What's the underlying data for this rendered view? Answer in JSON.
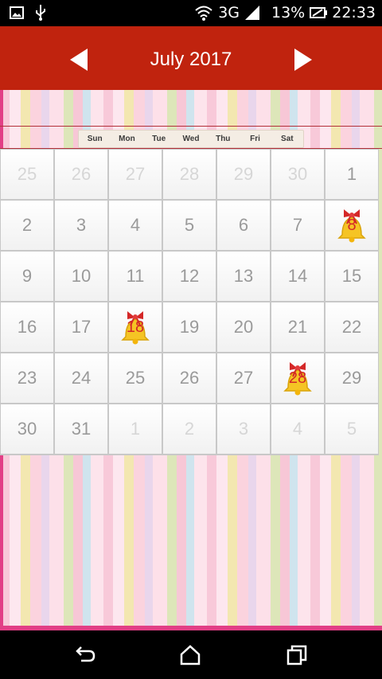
{
  "status_bar": {
    "network": "3G",
    "battery": "13%",
    "time": "22:33"
  },
  "header": {
    "title": "July 2017",
    "prev_icon": "left-triangle-icon",
    "next_icon": "right-triangle-icon"
  },
  "weekdays": [
    "Sun",
    "Mon",
    "Tue",
    "Wed",
    "Thu",
    "Fri",
    "Sat"
  ],
  "calendar": {
    "cells": [
      {
        "day": "25",
        "muted": true
      },
      {
        "day": "26",
        "muted": true
      },
      {
        "day": "27",
        "muted": true
      },
      {
        "day": "28",
        "muted": true
      },
      {
        "day": "29",
        "muted": true
      },
      {
        "day": "30",
        "muted": true
      },
      {
        "day": "1"
      },
      {
        "day": "2"
      },
      {
        "day": "3"
      },
      {
        "day": "4"
      },
      {
        "day": "5"
      },
      {
        "day": "6"
      },
      {
        "day": "7"
      },
      {
        "day": "8",
        "event": true
      },
      {
        "day": "9"
      },
      {
        "day": "10"
      },
      {
        "day": "11"
      },
      {
        "day": "12"
      },
      {
        "day": "13"
      },
      {
        "day": "14"
      },
      {
        "day": "15"
      },
      {
        "day": "16"
      },
      {
        "day": "17"
      },
      {
        "day": "18",
        "event": true
      },
      {
        "day": "19"
      },
      {
        "day": "20"
      },
      {
        "day": "21"
      },
      {
        "day": "22"
      },
      {
        "day": "23"
      },
      {
        "day": "24"
      },
      {
        "day": "25"
      },
      {
        "day": "26"
      },
      {
        "day": "27"
      },
      {
        "day": "28",
        "event": true
      },
      {
        "day": "29"
      },
      {
        "day": "30"
      },
      {
        "day": "31"
      },
      {
        "day": "1",
        "muted": true
      },
      {
        "day": "2",
        "muted": true
      },
      {
        "day": "3",
        "muted": true
      },
      {
        "day": "4",
        "muted": true
      },
      {
        "day": "5",
        "muted": true
      }
    ],
    "event_icon": "bell-icon"
  },
  "colors": {
    "header_bg": "#c0230e",
    "frame": "#e23f86",
    "bell_yellow": "#f5c424",
    "bow_red": "#d42727"
  },
  "navbar": {
    "back_icon": "back-icon",
    "home_icon": "home-icon",
    "recents_icon": "recents-icon"
  }
}
